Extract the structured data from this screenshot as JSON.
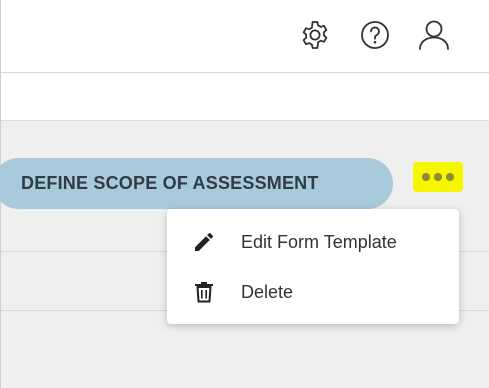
{
  "header": {
    "icons": {
      "settings": "gear-icon",
      "help": "question-circle-icon",
      "user": "user-icon"
    }
  },
  "workflow": {
    "stage_label": "DEFINE SCOPE OF ASSESSMENT",
    "stage_color": "#a9cadb",
    "more_button_highlight": "#f6f600"
  },
  "menu": {
    "items": [
      {
        "label": "Edit Form Template",
        "icon": "pencil-icon"
      },
      {
        "label": "Delete",
        "icon": "trash-icon"
      }
    ]
  }
}
